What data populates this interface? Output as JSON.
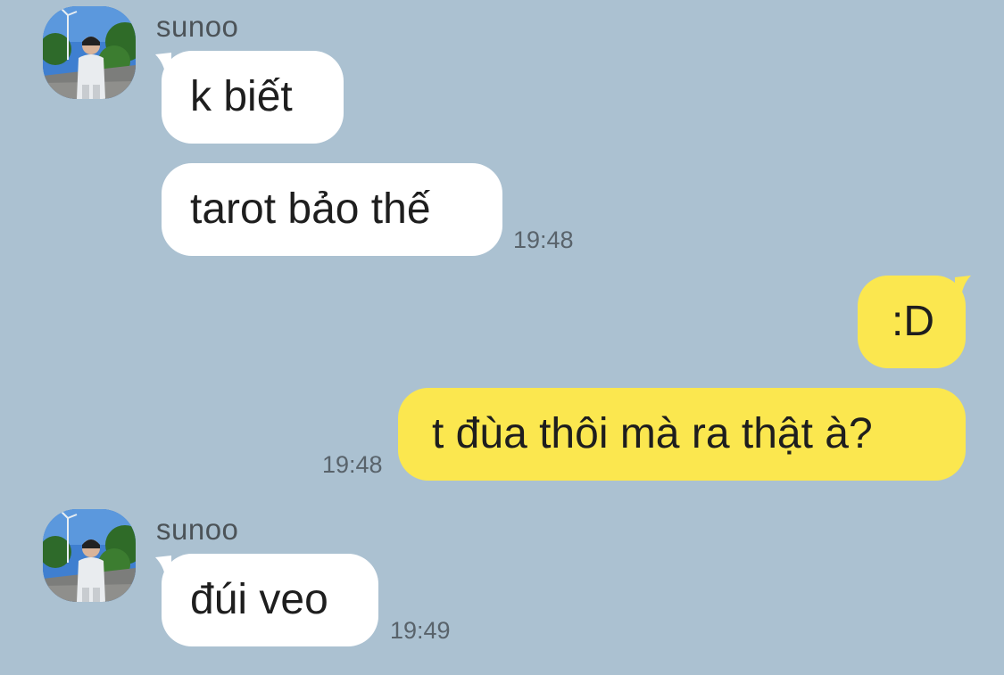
{
  "chat": {
    "colors": {
      "background": "#abc1d1",
      "incoming_bubble": "#ffffff",
      "outgoing_bubble": "#fbe74f",
      "timestamp": "#59636b"
    },
    "groups": [
      {
        "sender": "sunoo",
        "avatar": "profile-photo",
        "messages": [
          "k biết",
          "tarot bảo thế"
        ],
        "time": "19:48"
      },
      {
        "sender": "me",
        "messages": [
          ":D",
          "t đùa thôi mà ra thật à?"
        ],
        "time": "19:48"
      },
      {
        "sender": "sunoo",
        "avatar": "profile-photo",
        "messages": [
          "đúi veo"
        ],
        "time": "19:49"
      }
    ]
  }
}
